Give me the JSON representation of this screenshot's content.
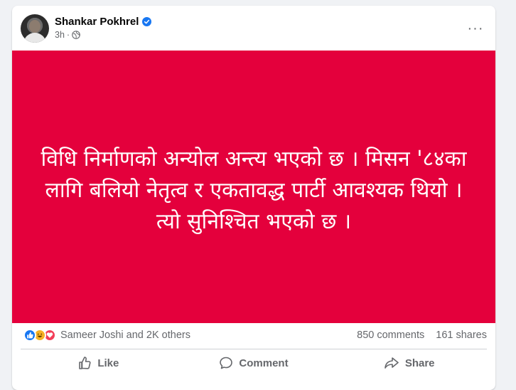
{
  "post": {
    "author": "Shankar Pokhrel",
    "time": "3h",
    "separator": "·",
    "more_label": "···",
    "media_text": "विधि निर्माणको अन्योल अन्त्य भएको छ । मिसन '८४का लागि बलियो नेतृत्व र एकतावद्ध पार्टी आवश्यक थियो । त्यो सुनिश्चित भएको छ ।",
    "media_background": "#e4003c"
  },
  "stats": {
    "reactions_text": "Sameer Joshi and 2K others",
    "comments": "850 comments",
    "shares": "161 shares"
  },
  "actions": {
    "like": "Like",
    "comment": "Comment",
    "share": "Share"
  },
  "icons": {
    "verified": "verified-badge-icon",
    "globe": "globe-icon",
    "more": "more-options-icon",
    "like": "thumbs-up-icon",
    "comment": "comment-bubble-icon",
    "share": "share-arrow-icon"
  },
  "colors": {
    "verified": "#1877f2",
    "like_reaction": "#1877f2",
    "haha_reaction": "#f7b125",
    "love_reaction": "#f33e58"
  }
}
